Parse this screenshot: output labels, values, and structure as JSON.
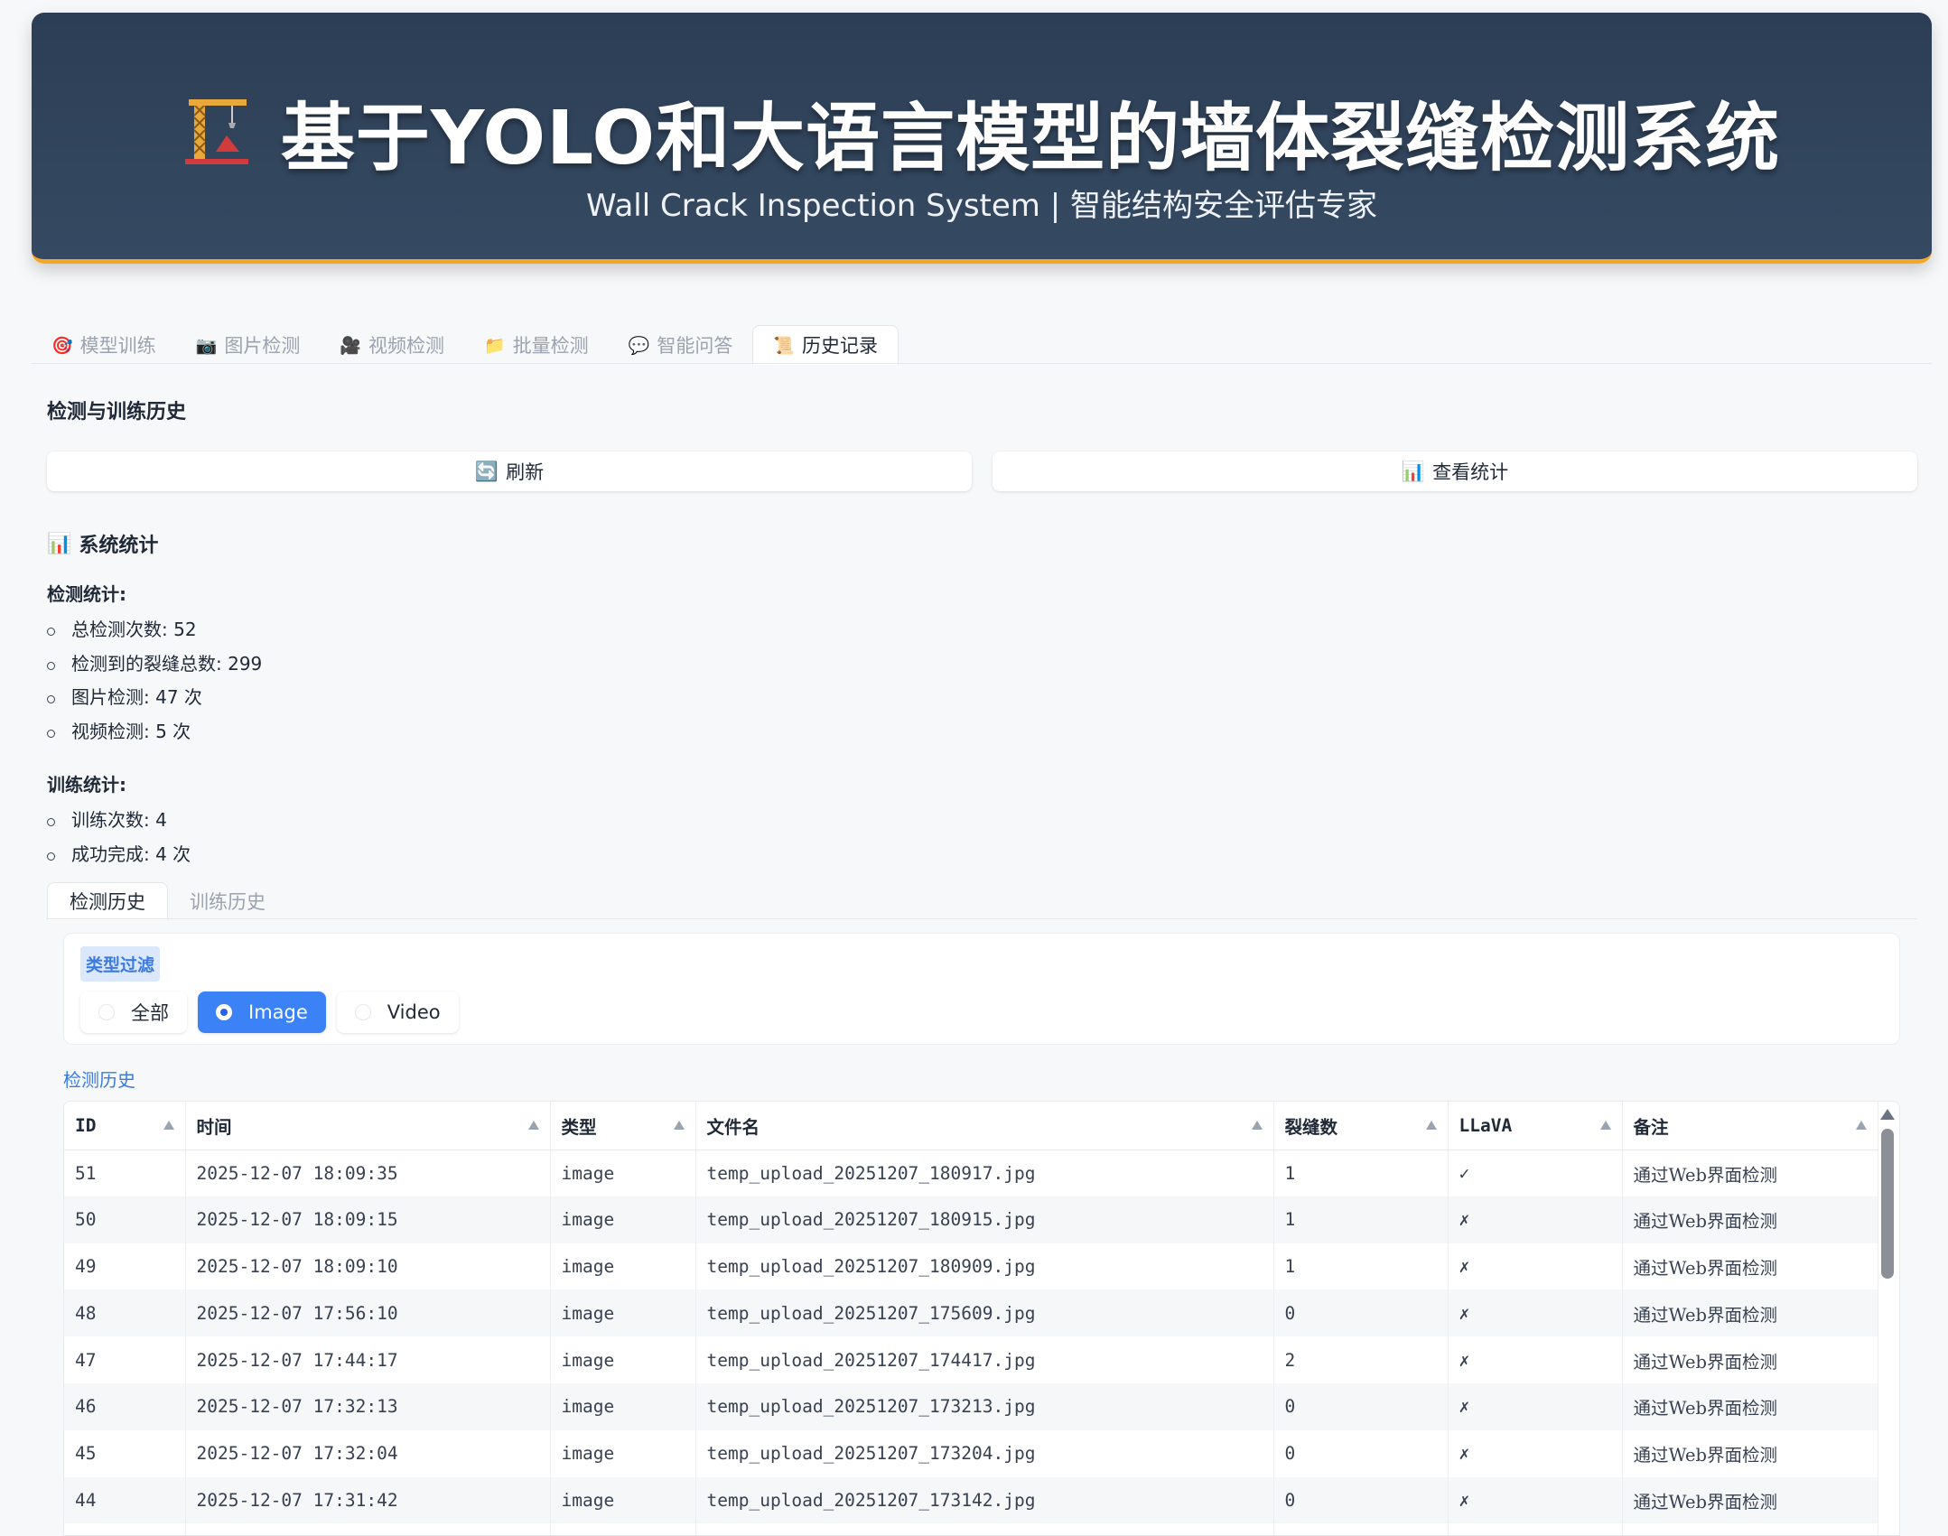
{
  "header": {
    "title": "基于YOLO和大语言模型的墙体裂缝检测系统",
    "subtitle": "Wall Crack Inspection System | 智能结构安全评估专家",
    "logo_icon": "crane-icon"
  },
  "main_tabs": [
    {
      "icon": "🎯",
      "label": "模型训练",
      "active": false
    },
    {
      "icon": "📷",
      "label": "图片检测",
      "active": false
    },
    {
      "icon": "🎥",
      "label": "视频检测",
      "active": false
    },
    {
      "icon": "📁",
      "label": "批量检测",
      "active": false
    },
    {
      "icon": "💬",
      "label": "智能问答",
      "active": false
    },
    {
      "icon": "📜",
      "label": "历史记录",
      "active": true
    }
  ],
  "page": {
    "section_title": "检测与训练历史",
    "refresh_label": "刷新",
    "refresh_icon": "🔄",
    "stats_label": "查看统计",
    "stats_icon": "📊"
  },
  "stats": {
    "heading": "系统统计",
    "heading_icon": "📊",
    "detection_title": "检测统计:",
    "detection_items": [
      "总检测次数: 52",
      "检测到的裂缝总数: 299",
      "图片检测: 47 次",
      "视频检测: 5 次"
    ],
    "training_title": "训练统计:",
    "training_items": [
      "训练次数: 4",
      "成功完成: 4 次"
    ]
  },
  "sub_tabs": [
    {
      "label": "检测历史",
      "active": true
    },
    {
      "label": "训练历史",
      "active": false
    }
  ],
  "filter": {
    "label": "类型过滤",
    "options": [
      {
        "label": "全部",
        "checked": false
      },
      {
        "label": "Image",
        "checked": true
      },
      {
        "label": "Video",
        "checked": false
      }
    ]
  },
  "table": {
    "caption": "检测历史",
    "columns": [
      "ID",
      "时间",
      "类型",
      "文件名",
      "裂缝数",
      "LLaVA",
      "备注"
    ],
    "rows": [
      [
        "51",
        "2025-12-07 18:09:35",
        "image",
        "temp_upload_20251207_180917.jpg",
        "1",
        "✓",
        "通过Web界面检测"
      ],
      [
        "50",
        "2025-12-07 18:09:15",
        "image",
        "temp_upload_20251207_180915.jpg",
        "1",
        "✗",
        "通过Web界面检测"
      ],
      [
        "49",
        "2025-12-07 18:09:10",
        "image",
        "temp_upload_20251207_180909.jpg",
        "1",
        "✗",
        "通过Web界面检测"
      ],
      [
        "48",
        "2025-12-07 17:56:10",
        "image",
        "temp_upload_20251207_175609.jpg",
        "0",
        "✗",
        "通过Web界面检测"
      ],
      [
        "47",
        "2025-12-07 17:44:17",
        "image",
        "temp_upload_20251207_174417.jpg",
        "2",
        "✗",
        "通过Web界面检测"
      ],
      [
        "46",
        "2025-12-07 17:32:13",
        "image",
        "temp_upload_20251207_173213.jpg",
        "0",
        "✗",
        "通过Web界面检测"
      ],
      [
        "45",
        "2025-12-07 17:32:04",
        "image",
        "temp_upload_20251207_173204.jpg",
        "0",
        "✗",
        "通过Web界面检测"
      ],
      [
        "44",
        "2025-12-07 17:31:42",
        "image",
        "temp_upload_20251207_173142.jpg",
        "0",
        "✗",
        "通过Web界面检测"
      ],
      [
        "",
        "",
        "",
        "",
        "",
        "",
        ""
      ]
    ]
  },
  "colors": {
    "header_bg": "#2c3e55",
    "header_accent": "#f5a623",
    "primary": "#3b82f6",
    "link": "#3b7be0"
  }
}
